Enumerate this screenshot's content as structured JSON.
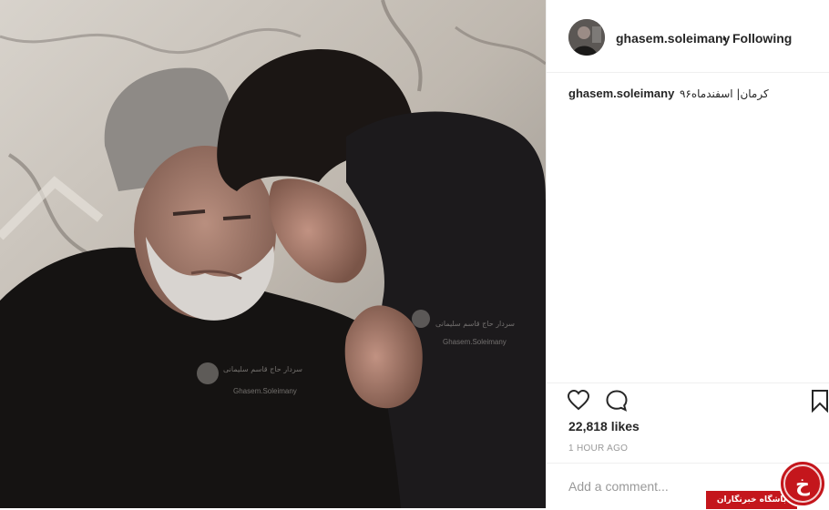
{
  "post": {
    "username": "ghasem.soleimany",
    "separator": "•",
    "follow_status": "Following",
    "caption_user": "ghasem.soleimany",
    "caption_text": "کرمان| اسفندماه۹۶",
    "likes": "22,818 likes",
    "time": "1 HOUR AGO",
    "comment_placeholder": "Add a comment..."
  },
  "photo": {
    "watermark_line1": "سردار حاج قاسم سلیمانی",
    "watermark_line2": "Ghasem.Soleimany"
  },
  "badge": {
    "text": "باشگاه خبرنگاران",
    "logo_glyph": "خ"
  },
  "icons": [
    "heart-icon",
    "comment-icon",
    "bookmark-icon"
  ]
}
